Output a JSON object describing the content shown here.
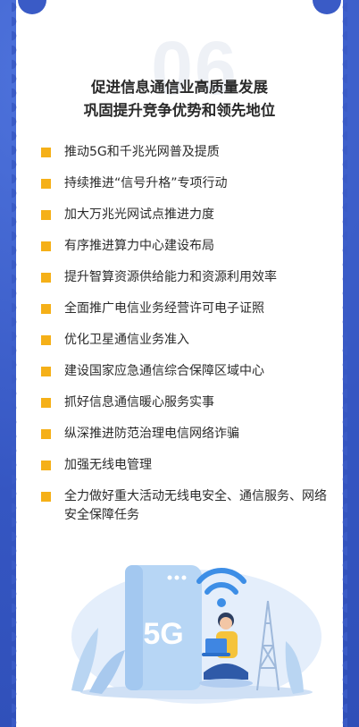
{
  "header": {
    "number_watermark": "06",
    "title_line1": "促进信息通信业高质量发展",
    "title_line2": "巩固提升竞争优势和领先地位"
  },
  "list_items": [
    "推动5G和千兆光网普及提质",
    "持续推进“信号升格”专项行动",
    "加大万兆光网试点推进力度",
    "有序推进算力中心建设布局",
    "提升智算资源供给能力和资源利用效率",
    "全面推广电信业务经营许可电子证照",
    "优化卫星通信业务准入",
    "建设国家应急通信综合保障区域中心",
    "抓好信息通信暖心服务实事",
    "纵深推进防范治理电信网络诈骗",
    "加强无线电管理",
    "全力做好重大活动无线电安全、通信服务、网络安全保障任务"
  ],
  "illustration": {
    "phone_label": "5G"
  },
  "colors": {
    "background": "#3a5bc6",
    "bullet": "#f5b018",
    "accent_light": "#cfe3f7"
  }
}
